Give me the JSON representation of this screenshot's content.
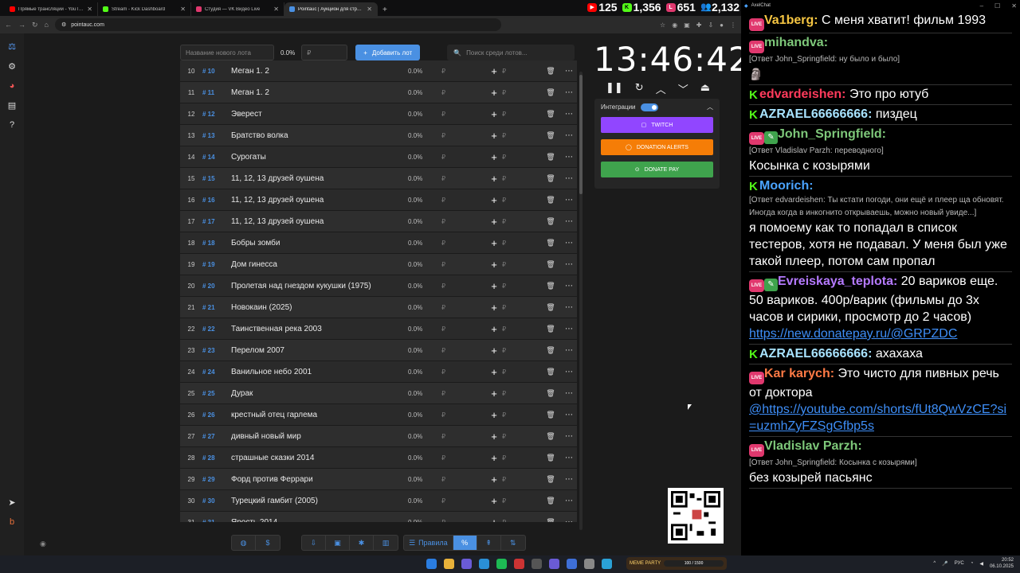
{
  "tabs": [
    {
      "label": "Прямые трансляции - YouTube",
      "color": "#ff0000"
    },
    {
      "label": "Stream - Kick Dashboard",
      "color": "#53fc18"
    },
    {
      "label": "Студия — VK Видео Live",
      "color": "#e0386e"
    },
    {
      "label": "Pointauc | Аукцион для стрима",
      "color": "#4a90e2",
      "active": true
    }
  ],
  "stats": {
    "youtube": "125",
    "kick": "1,356",
    "vk": "651",
    "viewers": "2,132"
  },
  "url": "pointauc.com",
  "lot": {
    "name_placeholder": "Название нового лота",
    "percent": "0.0%",
    "amount_placeholder": "₽",
    "add_label": "Добавить лот",
    "search_placeholder": "Поиск среди лотов..."
  },
  "lots": [
    {
      "idx": "10",
      "id": "# 10",
      "name": "Меган 1. 2",
      "pct": "0.0%"
    },
    {
      "idx": "11",
      "id": "# 11",
      "name": "Меган 1. 2",
      "pct": "0.0%"
    },
    {
      "idx": "12",
      "id": "# 12",
      "name": "Эверест",
      "pct": "0.0%"
    },
    {
      "idx": "13",
      "id": "# 13",
      "name": "Братство волка",
      "pct": "0.0%"
    },
    {
      "idx": "14",
      "id": "# 14",
      "name": "Сурогаты",
      "pct": "0.0%"
    },
    {
      "idx": "15",
      "id": "# 15",
      "name": "11, 12, 13 друзей оушена",
      "pct": "0.0%"
    },
    {
      "idx": "16",
      "id": "# 16",
      "name": "11, 12, 13 друзей оушена",
      "pct": "0.0%"
    },
    {
      "idx": "17",
      "id": "# 17",
      "name": "11, 12, 13 друзей оушена",
      "pct": "0.0%"
    },
    {
      "idx": "18",
      "id": "# 18",
      "name": "Бобры зомби",
      "pct": "0.0%"
    },
    {
      "idx": "19",
      "id": "# 19",
      "name": "Дом гинесса",
      "pct": "0.0%"
    },
    {
      "idx": "20",
      "id": "# 20",
      "name": "Пролетая над гнездом кукушки (1975)",
      "pct": "0.0%"
    },
    {
      "idx": "21",
      "id": "# 21",
      "name": "Новокаин (2025)",
      "pct": "0.0%"
    },
    {
      "idx": "22",
      "id": "# 22",
      "name": "Таинственная река 2003",
      "pct": "0.0%"
    },
    {
      "idx": "23",
      "id": "# 23",
      "name": "Перелом 2007",
      "pct": "0.0%"
    },
    {
      "idx": "24",
      "id": "# 24",
      "name": "Ванильное небо 2001",
      "pct": "0.0%"
    },
    {
      "idx": "25",
      "id": "# 25",
      "name": "Дурак",
      "pct": "0.0%"
    },
    {
      "idx": "26",
      "id": "# 26",
      "name": "крестный отец гарлема",
      "pct": "0.0%"
    },
    {
      "idx": "27",
      "id": "# 27",
      "name": "дивный новый мир",
      "pct": "0.0%"
    },
    {
      "idx": "28",
      "id": "# 28",
      "name": "страшные сказки 2014",
      "pct": "0.0%"
    },
    {
      "idx": "29",
      "id": "# 29",
      "name": "Форд против Феррари",
      "pct": "0.0%"
    },
    {
      "idx": "30",
      "id": "# 30",
      "name": "Турецкий гамбит (2005)",
      "pct": "0.0%"
    },
    {
      "idx": "31",
      "id": "# 31",
      "name": "Ярость 2014",
      "pct": "0.0%"
    }
  ],
  "rub": "₽",
  "timer": "13:46:42",
  "integrations": {
    "title": "Интеграции",
    "twitch": "TWITCH",
    "donation_alerts": "DONATION ALERTS",
    "donate_pay": "DONATE PAY",
    "colors": {
      "twitch": "#9146ff",
      "da": "#f57d07",
      "dp": "#3fa34d"
    }
  },
  "bottom": {
    "rules": "Правила"
  },
  "chat": {
    "title": "AxelChat",
    "messages": [
      {
        "platform": "live",
        "user": "Va1berg:",
        "color": "#f5c542",
        "text": "С меня хватит! фильм 1993"
      },
      {
        "platform": "live",
        "user": "mihandva:",
        "color": "#7ec87a",
        "reply": "[Ответ John_Springfield: ну было и было]",
        "text": ""
      },
      {
        "platform": "kick",
        "user": "edvardeishen:",
        "color": "#ff3b5c",
        "text": "Это про ютуб"
      },
      {
        "platform": "kick",
        "user": "AZRAEL66666666:",
        "color": "#a8e3ff",
        "text": "пиздец"
      },
      {
        "platform": "live",
        "user": "John_Springfield:",
        "color": "#7ec87a",
        "reply": "[Ответ Vladislav Parzh: переводного]",
        "text": "Косынка с козырями"
      },
      {
        "platform": "kick",
        "user": "Moorich:",
        "color": "#4aa3ff",
        "reply": "[Ответ edvardeishen: Ты кстати погоди, они ещё и плеер ща обновят. Иногда когда в инкогнито открываешь, можно новый увиде...]",
        "text": "я помоему как то попадал в список тестеров, хотя не подавал. У меня был уже такой плеер, потом сам пропал"
      },
      {
        "platform": "live",
        "user": "Evreiskaya_teplota:",
        "color": "#b57aff",
        "text": "20 вариков еще. 50 вариков. 400р/варик (фильмы до 3х часов и сирики, просмотр до 2 часов)",
        "link": "https://new.donatepay.ru/@GRPZDC"
      },
      {
        "platform": "kick",
        "user": "AZRAEL66666666:",
        "color": "#a8e3ff",
        "text": "ахахаха"
      },
      {
        "platform": "live",
        "user": "Kar karych:",
        "color": "#ff7a45",
        "text": "Это чисто для пивных речь от доктора",
        "link": "@https://youtube.com/shorts/fUt8QwVzCE?si=uzmhZyFZSgGfbp5s"
      },
      {
        "platform": "live",
        "user": "Vladislav Parzh:",
        "color": "#7ec87a",
        "reply": "[Ответ John_Springfield: Косынка с козырями]",
        "text": "без козырей пасьянс"
      }
    ]
  },
  "taskbar": {
    "meme_label": "MEME PARTY",
    "meme_progress": "100 / 1500",
    "lang": "РУС",
    "time": "20:52",
    "date": "06.10.2025"
  }
}
